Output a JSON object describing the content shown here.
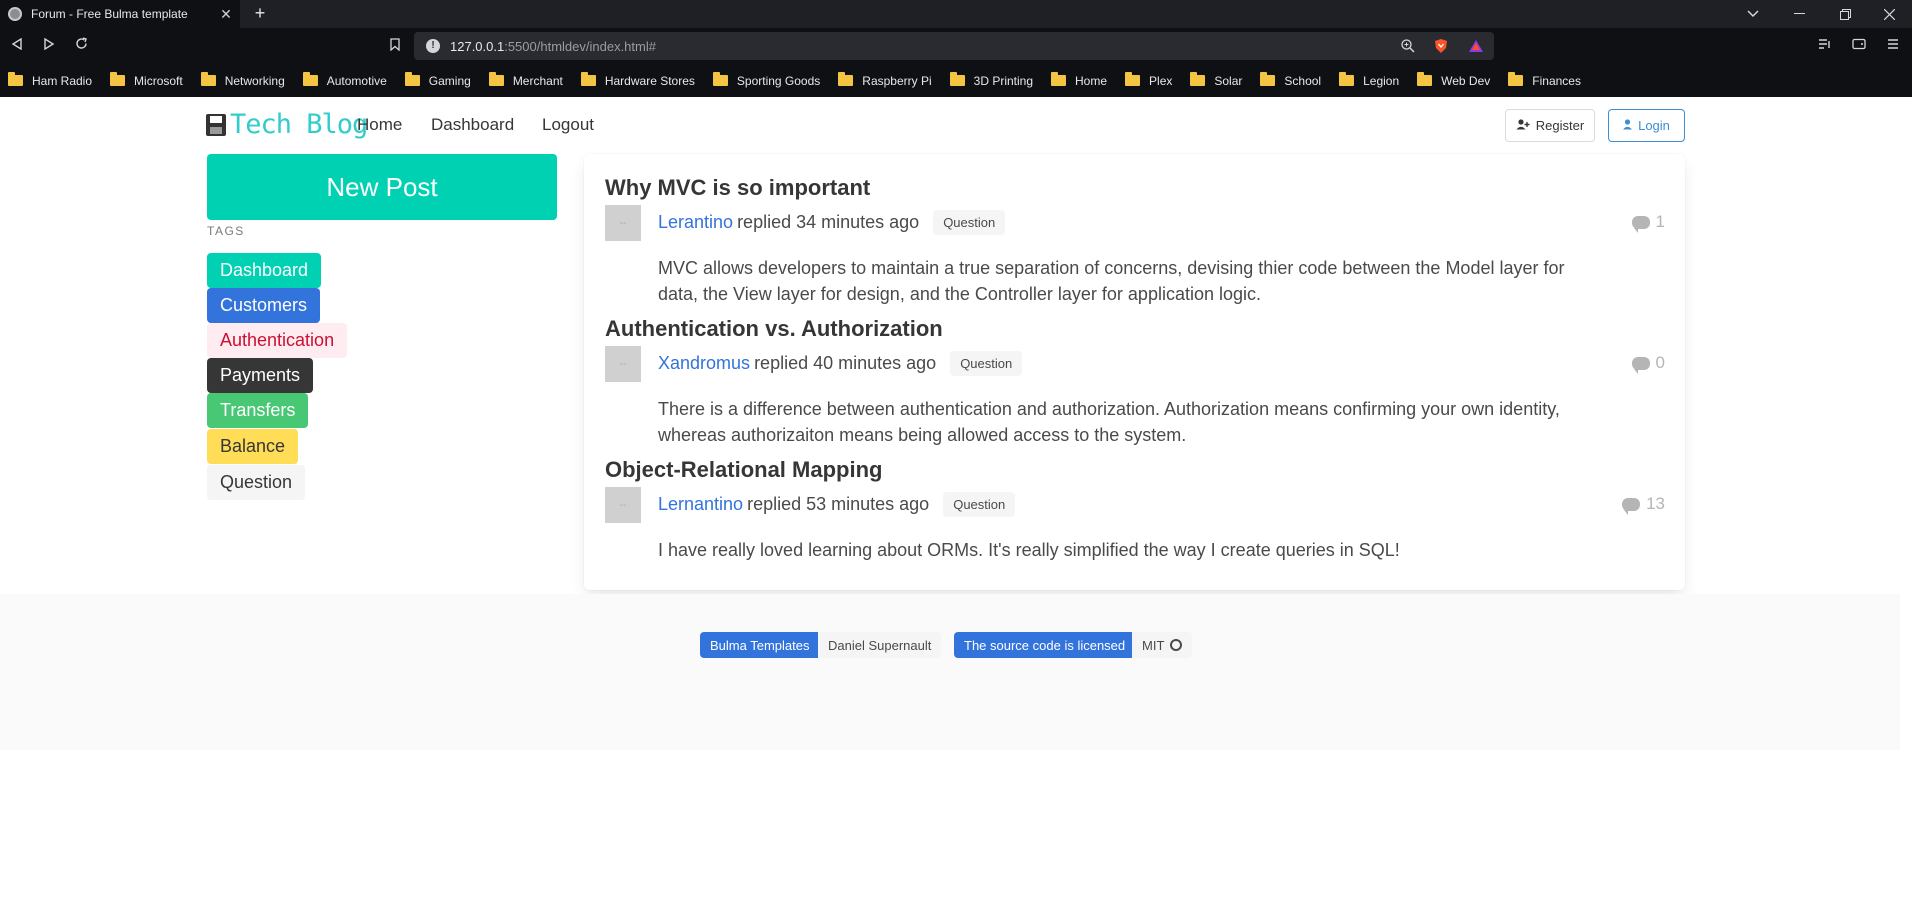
{
  "browser": {
    "tab_title": "Forum - Free Bulma template",
    "tab_close": "✕",
    "new_tab": "+",
    "url_host": "127.0.0.1",
    "url_path": ":5500/htmldev/index.html#",
    "bookmarks": [
      "Ham Radio",
      "Microsoft",
      "Networking",
      "Automotive",
      "Gaming",
      "Merchant",
      "Hardware Stores",
      "Sporting Goods",
      "Raspberry Pi",
      "3D Printing",
      "Home",
      "Plex",
      "Solar",
      "School",
      "Legion",
      "Web Dev",
      "Finances"
    ]
  },
  "site": {
    "brand": "Tech Blog",
    "nav": [
      "Home",
      "Dashboard",
      "Logout"
    ],
    "register_label": "Register",
    "login_label": "Login",
    "new_post_label": "New Post",
    "tags_heading": "TAGS"
  },
  "tags": [
    {
      "label": "Dashboard",
      "bg": "#00d1b2",
      "fg": "#ffffff"
    },
    {
      "label": "Customers",
      "bg": "#3273dc",
      "fg": "#ffffff"
    },
    {
      "label": "Authentication",
      "bg": "#feecf0",
      "fg": "#cc0f35"
    },
    {
      "label": "Payments",
      "bg": "#363636",
      "fg": "#ffffff"
    },
    {
      "label": "Transfers",
      "bg": "#48c774",
      "fg": "#ffffff"
    },
    {
      "label": "Balance",
      "bg": "#ffdd57",
      "fg": "#363636"
    },
    {
      "label": "Question",
      "bg": "#f5f5f5",
      "fg": "#363636"
    }
  ],
  "posts": [
    {
      "title": "Why MVC is so important",
      "author": "Lerantino",
      "replied": "replied 34 minutes ago",
      "badge": "Question",
      "count": "1",
      "body": "MVC allows developers to maintain a true separation of concerns, devising thier code between the Model layer for data, the View layer for design, and the Controller layer for application logic."
    },
    {
      "title": "Authentication vs. Authorization",
      "author": "Xandromus",
      "replied": "replied 40 minutes ago",
      "badge": "Question",
      "count": "0",
      "body": "There is a difference between authentication and authorization. Authorization means confirming your own identity, whereas authorizaiton means being allowed access to the system."
    },
    {
      "title": "Object-Relational Mapping",
      "author": "Lernantino",
      "replied": "replied 53 minutes ago",
      "badge": "Question",
      "count": "13",
      "body": "I have really loved learning about ORMs. It's really simplified the way I create queries in SQL!"
    }
  ],
  "footer": {
    "bulma_templates": "Bulma Templates",
    "author": "Daniel Supernault",
    "source_label": "The source code is licensed",
    "license": "MIT"
  }
}
